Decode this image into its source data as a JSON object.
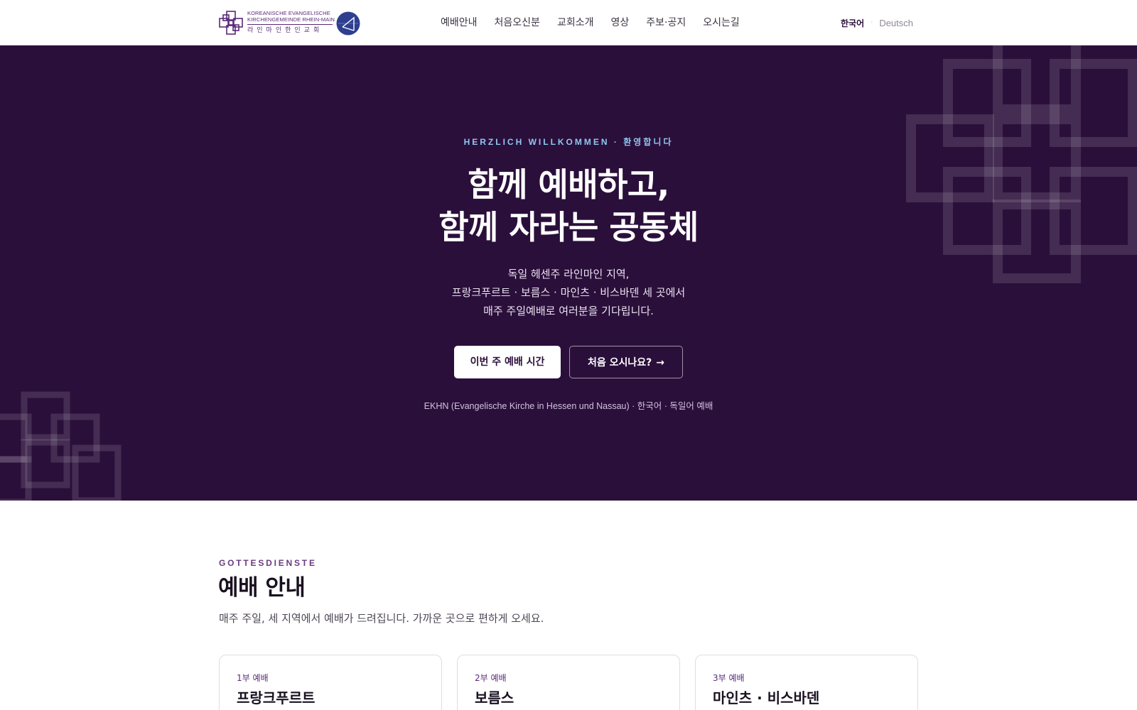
{
  "header": {
    "logo": {
      "line1": "KOREANISCHE EVANGELISCHE",
      "line2": "KIRCHENGEMEINDE RHEIN-MAIN",
      "korean": "라인마인한인교회"
    },
    "nav": [
      {
        "label": "예배안내"
      },
      {
        "label": "처음오신분"
      },
      {
        "label": "교회소개"
      },
      {
        "label": "영상"
      },
      {
        "label": "주보·공지"
      },
      {
        "label": "오시는길"
      }
    ],
    "lang": {
      "active": "한국어",
      "separator": "·",
      "other": "Deutsch"
    }
  },
  "hero": {
    "eyebrow": "HERZLICH WILLKOMMEN · 환영합니다",
    "title_line1": "함께 예배하고,",
    "title_line2": "함께 자라는 공동체",
    "sub_line1": "독일 헤센주 라인마인 지역,",
    "sub_line2": "프랑크푸르트 · 보름스 · 마인츠 · 비스바덴 세 곳에서",
    "sub_line3": "매주 주일예배로 여러분을 기다립니다.",
    "primary_button": "이번 주 예배 시간",
    "secondary_button": "처음 오시나요?",
    "secondary_arrow": "→",
    "footnote": "EKHN (Evangelische Kirche in Hessen und Nassau) · 한국어 · 독일어 예배"
  },
  "services": {
    "eyebrow": "GOTTESDIENSTE",
    "title": "예배 안내",
    "description": "매주 주일, 세 지역에서 예배가 드려집니다. 가까운 곳으로 편하게 오세요.",
    "cards": [
      {
        "label": "1부 예배",
        "title": "프랑크푸르트"
      },
      {
        "label": "2부 예배",
        "title": "보름스"
      },
      {
        "label": "3부 예배",
        "title": "마인츠 · 비스바덴"
      }
    ]
  },
  "colors": {
    "brand": "#2b0f3b",
    "accent": "#5a2a78",
    "eyebrow_hero": "#8fc8ee",
    "logo_circle": "#2e3f8f"
  },
  "icons": [
    "cross-pattern-logo-icon",
    "circle-emblem-icon",
    "arrow-right-icon"
  ]
}
